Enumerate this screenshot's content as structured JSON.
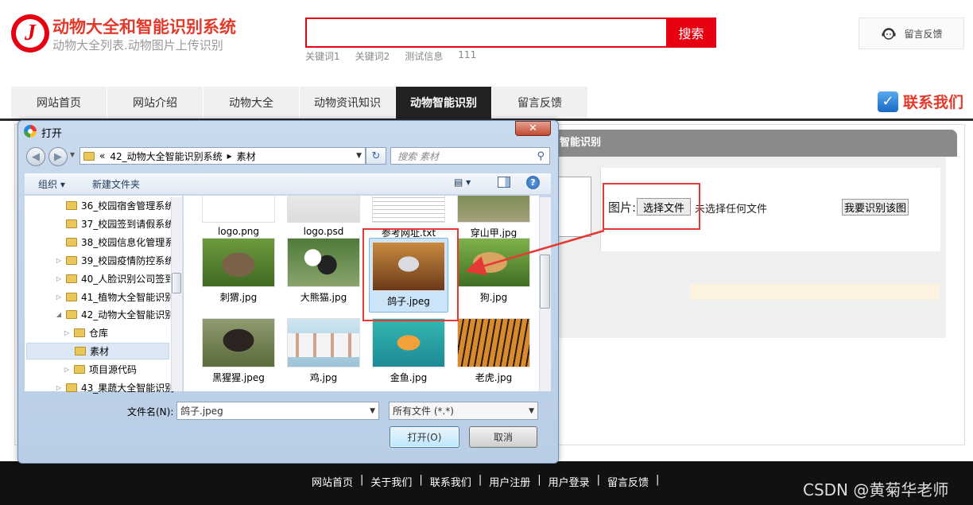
{
  "site": {
    "title": "动物大全和智能识别系统",
    "subtitle": "动物大全列表.动物图片上传识别",
    "logo_letter": "J"
  },
  "search": {
    "placeholder": "",
    "button": "搜索",
    "keywords": [
      "关键词1",
      "关键词2",
      "测试信息",
      "111"
    ]
  },
  "header": {
    "feedback": "留言反馈",
    "contact": "联系我们"
  },
  "nav": {
    "tabs": [
      {
        "label": "网站首页"
      },
      {
        "label": "网站介绍"
      },
      {
        "label": "动物大全"
      },
      {
        "label": "动物资讯知识"
      },
      {
        "label": "动物智能识别",
        "active": true
      },
      {
        "label": "留言反馈"
      }
    ]
  },
  "panel": {
    "header": "智能识别",
    "image_label": "图片:",
    "choose_file": "选择文件",
    "no_file": "未选择任何文件",
    "identify": "我要识别该图"
  },
  "dialog": {
    "title": "打开",
    "close": "✕",
    "address": {
      "prefix": "«",
      "crumbs": [
        "42_动物大全智能识别系统",
        "素材"
      ],
      "separator": "▸"
    },
    "search_placeholder": "搜索 素材",
    "toolbar": {
      "organize": "组织 ▾",
      "new_folder": "新建文件夹",
      "view": "▤ ▾"
    },
    "tree": [
      {
        "label": "36_校园宿舍管理系统",
        "depth": 0,
        "arrow": ""
      },
      {
        "label": "37_校园签到请假系统",
        "depth": 0,
        "arrow": ""
      },
      {
        "label": "38_校园信息化管理系",
        "depth": 0,
        "arrow": ""
      },
      {
        "label": "39_校园疫情防控系统",
        "depth": 0,
        "arrow": "▷"
      },
      {
        "label": "40_人脸识别公司签到",
        "depth": 0,
        "arrow": "▷"
      },
      {
        "label": "41_植物大全智能识别",
        "depth": 0,
        "arrow": "▷"
      },
      {
        "label": "42_动物大全智能识别",
        "depth": 0,
        "arrow": "◢"
      },
      {
        "label": "仓库",
        "depth": 1,
        "arrow": "▷"
      },
      {
        "label": "素材",
        "depth": 1,
        "arrow": "",
        "selected": true
      },
      {
        "label": "项目源代码",
        "depth": 1,
        "arrow": "▷"
      },
      {
        "label": "43_果蔬大全智能识别",
        "depth": 0,
        "arrow": "▷"
      }
    ],
    "files": [
      {
        "name": "logo.png",
        "thumb": "logo"
      },
      {
        "name": "logo.psd",
        "thumb": "psd"
      },
      {
        "name": "参考网址.txt",
        "thumb": "txt"
      },
      {
        "name": "穿山甲.jpg",
        "thumb": "pangolin"
      },
      {
        "name": "刺猬.jpg",
        "thumb": "hedgehog"
      },
      {
        "name": "大熊猫.jpg",
        "thumb": "panda"
      },
      {
        "name": "鸽子.jpeg",
        "thumb": "pigeon",
        "selected": true
      },
      {
        "name": "狗.jpg",
        "thumb": "dog"
      },
      {
        "name": "黑猩猩.jpeg",
        "thumb": "chimp"
      },
      {
        "name": "鸡.jpg",
        "thumb": "chicken"
      },
      {
        "name": "金鱼.jpg",
        "thumb": "goldfish"
      },
      {
        "name": "老虎.jpg",
        "thumb": "tiger"
      }
    ],
    "filename_label": "文件名(N):",
    "filename_value": "鸽子.jpeg",
    "filetype": "所有文件 (*.*)",
    "open": "打开(O)",
    "cancel": "取消"
  },
  "footer": {
    "links": [
      "网站首页",
      "关于我们",
      "联系我们",
      "用户注册",
      "用户登录",
      "留言反馈"
    ]
  },
  "watermark": "CSDN @黄菊华老师",
  "colors": {
    "brand_red": "#e60012",
    "nav_active": "#222222",
    "highlight": "#e53935"
  }
}
